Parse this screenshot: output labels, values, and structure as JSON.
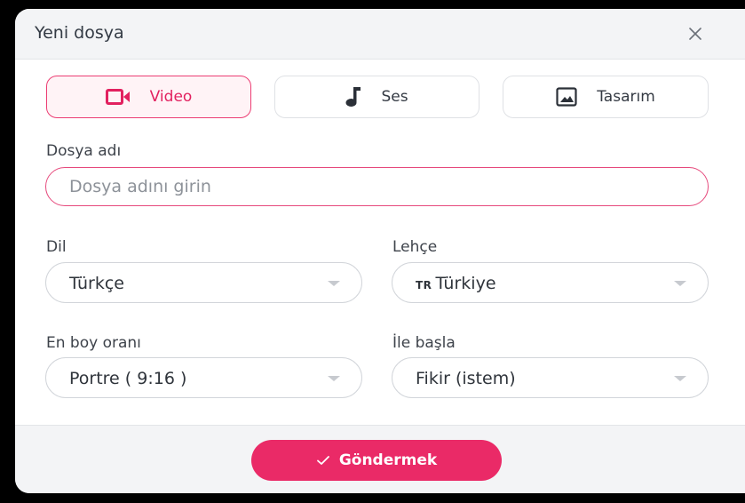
{
  "dialog": {
    "title": "Yeni dosya",
    "close_icon": "close-icon"
  },
  "types": [
    {
      "label": "Video",
      "icon": "video-camera-icon",
      "active": true
    },
    {
      "label": "Ses",
      "icon": "music-note-icon",
      "active": false
    },
    {
      "label": "Tasarım",
      "icon": "image-icon",
      "active": false
    }
  ],
  "file_name": {
    "label": "Dosya adı",
    "placeholder": "Dosya adını girin",
    "value": ""
  },
  "language": {
    "label": "Dil",
    "value": "Türkçe"
  },
  "dialect": {
    "label": "Lehçe",
    "flag": "TR",
    "value": "Türkiye"
  },
  "aspect_ratio": {
    "label": "En boy oranı",
    "value": "Portre ( 9:16 )"
  },
  "start_with": {
    "label": "İle başla",
    "value": "Fikir (istem)"
  },
  "submit": {
    "label": "Göndermek",
    "icon": "check-icon"
  },
  "colors": {
    "accent": "#ea2a67",
    "accent_light": "#fff3f6",
    "header_bg": "#f3f4f6",
    "backdrop": "#000000"
  }
}
